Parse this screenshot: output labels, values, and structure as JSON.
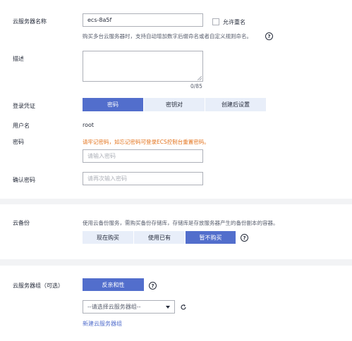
{
  "server_name": {
    "label": "云服务器名称",
    "value": "ecs-8a5f",
    "allow_duplicate_label": "允许重名",
    "hint": "购买多台云服务器时，支持自动增加数字后缀命名或者自定义规则命名。",
    "help": "?"
  },
  "description": {
    "label": "描述",
    "counter": "0/85"
  },
  "login": {
    "label": "登录凭证",
    "options": [
      "密码",
      "密钥对",
      "创建后设置"
    ],
    "selected": "密码"
  },
  "username": {
    "label": "用户名",
    "value": "root"
  },
  "password": {
    "label": "密码",
    "warning": "请牢记密码，如忘记密码可登录ECS控制台重置密码。",
    "placeholder": "请输入密码"
  },
  "confirm_password": {
    "label": "确认密码",
    "placeholder": "请再次输入密码"
  },
  "backup": {
    "label": "云备份",
    "hint": "使用云备份服务，需购买备份存储库，存储库是存放服务器产生的备份副本的容器。",
    "options": [
      "现在购买",
      "使用已有",
      "暂不购买"
    ],
    "selected": "暂不购买",
    "help": "?"
  },
  "server_group": {
    "label": "云服务器组（可选）",
    "anti_affinity_button": "反亲和性",
    "help": "?",
    "select_placeholder": "--请选择云服务器组--",
    "new_link": "新建云服务器组"
  },
  "colors": {
    "primary": "#526ecc",
    "segment_bg": "#e8eef9",
    "warning": "#e3721b",
    "border": "#adb0b8"
  },
  "icons": [
    "help-icon",
    "refresh-icon",
    "caret-down-icon",
    "checkbox-icon"
  ]
}
